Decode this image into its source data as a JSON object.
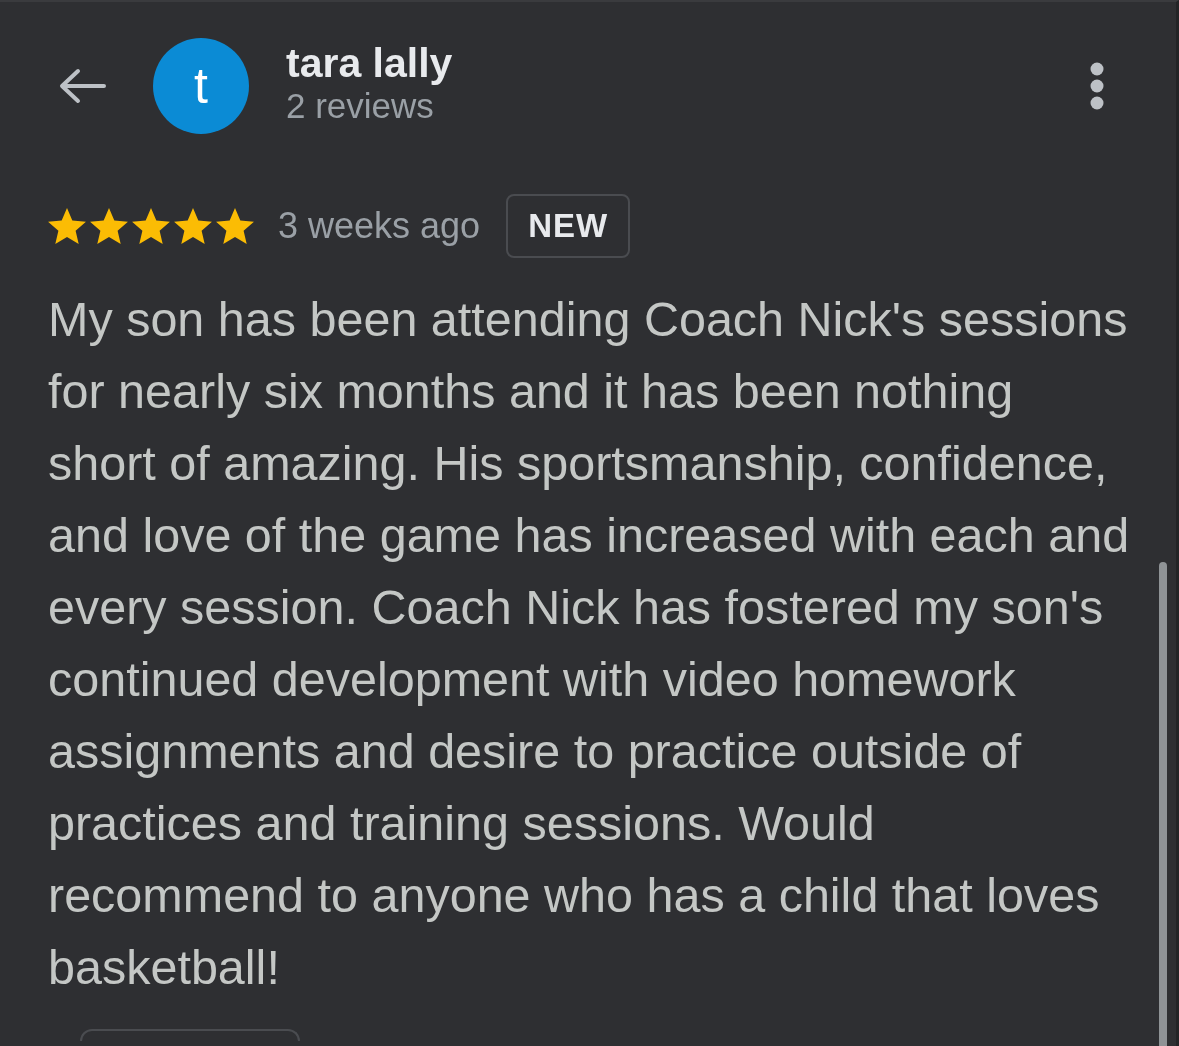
{
  "reviewer": {
    "initial": "t",
    "name": "tara lally",
    "review_count": "2 reviews"
  },
  "review": {
    "stars": 5,
    "time": "3 weeks ago",
    "badge": "NEW",
    "text_lines": [
      "My son has been attending Coach Nick's sessions",
      "for nearly six months and it has been nothing",
      "short of amazing. His sportsmanship, confidence,",
      "and love of the game has increased with each and",
      "every session. Coach Nick has fostered my son's",
      "continued development with video homework",
      "assignments and desire to practice outside of",
      "practices and training sessions. Would",
      "recommend to anyone who has a child that loves",
      "basketball!"
    ]
  }
}
